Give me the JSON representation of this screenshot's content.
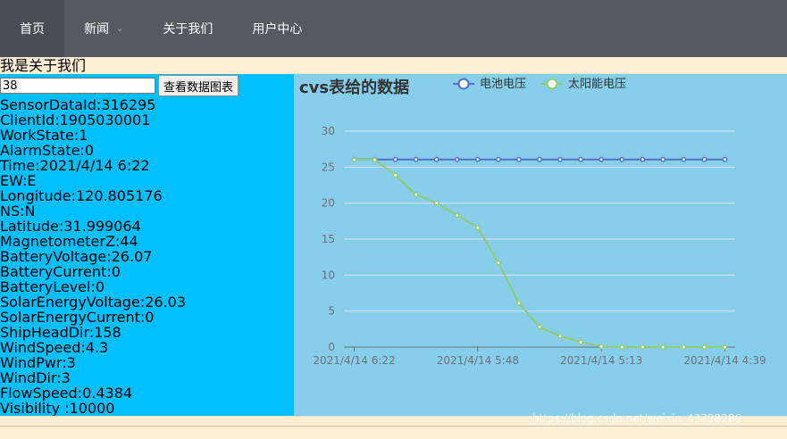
{
  "nav": {
    "items": [
      {
        "label": "首页",
        "active": true
      },
      {
        "label": "新闻",
        "dropdown": true
      },
      {
        "label": "关于我们"
      },
      {
        "label": "用户中心"
      }
    ],
    "dropdown_icon": "chevron-down-icon"
  },
  "about_text": "我是关于我们",
  "query": {
    "input_value": "38",
    "button_label": "查看数据图表"
  },
  "fields": [
    "SensorDataId:316295",
    "ClientId:1905030001",
    "WorkState:1",
    "AlarmState:0",
    "Time:2021/4/14 6:22",
    "EW:E",
    "Longitude:120.805176",
    "NS:N",
    "Latitude:31.999064",
    "MagnetometerZ:44",
    "BatteryVoltage:26.07",
    "BatteryCurrent:0",
    "BatteryLevel:0",
    "SolarEnergyVoltage:26.03",
    "SolarEnergyCurrent:0",
    "ShipHeadDir:158",
    "WindSpeed:4.3",
    "WindPwr:3",
    "WindDir:3",
    "FlowSpeed:0.4384",
    "Visibility :10000"
  ],
  "watermark": "https://blog.csdn.net/weixin_43798286",
  "chart_data": {
    "type": "line",
    "title": "cvs表给的数据",
    "x_tick_labels": [
      "2021/4/14 6:22",
      "2021/4/14 5:48",
      "2021/4/14 5:13",
      "2021/4/14 4:39"
    ],
    "y_ticks": [
      0,
      5,
      10,
      15,
      20,
      25,
      30
    ],
    "ylim": [
      0,
      30
    ],
    "grid": true,
    "legend_position": "top",
    "series": [
      {
        "name": "电池电压",
        "color": "#5470c6",
        "values": [
          26.07,
          26.07,
          26.07,
          26.07,
          26.07,
          26.07,
          26.07,
          26.07,
          26.07,
          26.07,
          26.07,
          26.07,
          26.07,
          26.07,
          26.07,
          26.07,
          26.07,
          26.07,
          26.07
        ]
      },
      {
        "name": "太阳能电压",
        "color": "#91cc75",
        "values": [
          26.03,
          26.03,
          23.9,
          21.2,
          20.0,
          18.3,
          16.6,
          11.7,
          6.1,
          2.8,
          1.5,
          0.7,
          0.1,
          0,
          0,
          0,
          0,
          0,
          0
        ]
      }
    ]
  }
}
